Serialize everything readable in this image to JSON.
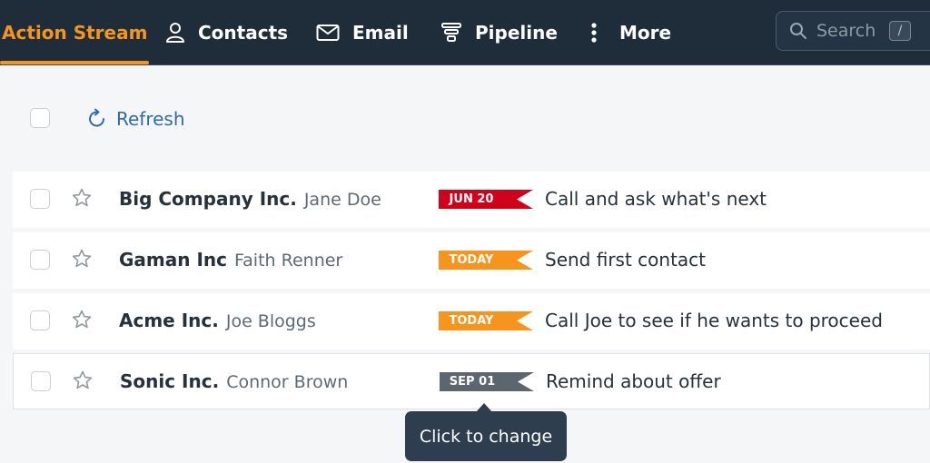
{
  "nav": {
    "items": [
      {
        "label": "Action Stream",
        "icon": "action-stream",
        "active": true
      },
      {
        "label": "Contacts",
        "icon": "person-icon"
      },
      {
        "label": "Email",
        "icon": "envelope-icon"
      },
      {
        "label": "Pipeline",
        "icon": "funnel-icon"
      },
      {
        "label": "More",
        "icon": "vertical-dots-icon"
      }
    ],
    "search_placeholder": "Search",
    "search_shortcut": "/"
  },
  "toolbar": {
    "refresh_label": "Refresh"
  },
  "rows": [
    {
      "company": "Big Company Inc.",
      "person": "Jane Doe",
      "date": "JUN 20",
      "date_color": "#d0021b",
      "task": "Call and ask what's next"
    },
    {
      "company": "Gaman Inc",
      "person": "Faith Renner",
      "date": "TODAY",
      "date_color": "#f7941d",
      "task": "Send first contact"
    },
    {
      "company": "Acme Inc.",
      "person": "Joe Bloggs",
      "date": "TODAY",
      "date_color": "#f7941d",
      "task": "Call Joe to see if he wants to proceed"
    },
    {
      "company": "Sonic Inc.",
      "person": "Connor Brown",
      "date": "SEP 01",
      "date_color": "#5b6670",
      "task": "Remind about offer"
    }
  ],
  "tooltip": {
    "text": "Click to change"
  },
  "colors": {
    "topbar": "#1f2d3b",
    "accent": "#f7941d",
    "link": "#2f6ab0"
  }
}
